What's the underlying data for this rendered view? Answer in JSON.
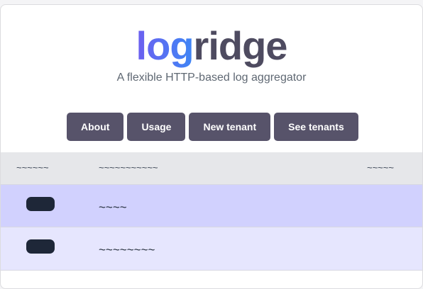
{
  "app": {
    "logo_part1": "log",
    "logo_part2": "ridge",
    "tagline": "A flexible HTTP-based log aggregator"
  },
  "nav": {
    "about": "About",
    "usage": "Usage",
    "new_tenant": "New tenant",
    "see_tenants": "See tenants"
  },
  "table": {
    "headers": [
      "~~~~~~",
      "~~~~~~~~~~~",
      "~~~~~"
    ],
    "rows": [
      {
        "name": "~~~~"
      },
      {
        "name": "~~~~~~~~"
      }
    ]
  },
  "colors": {
    "button": "#57536a",
    "logo_gradient_start": "#6d5ff0",
    "logo_gradient_end": "#3e86f5",
    "row_1": "#d1d1fe",
    "row_2": "#e6e6fe",
    "header_row": "#e6e7ea"
  }
}
